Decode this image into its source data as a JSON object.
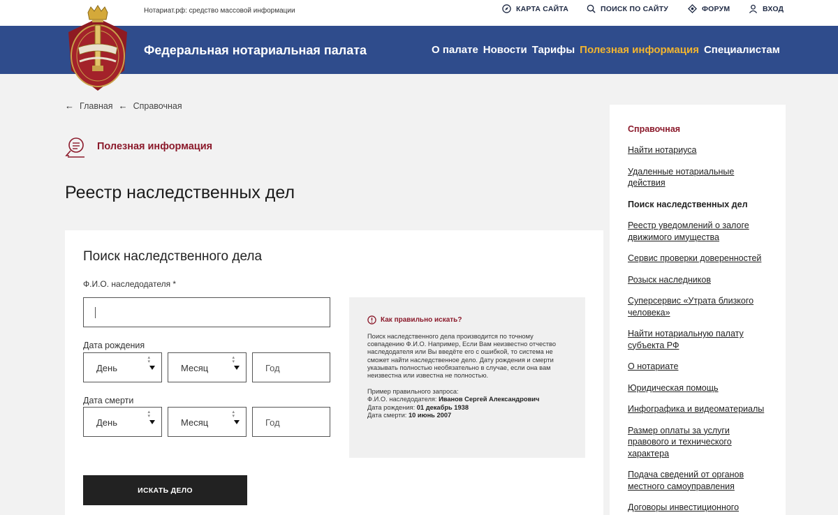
{
  "topbar": {
    "media_text": "Нотариат.рф: средство массовой информации",
    "links": [
      {
        "label": "КАРТА САЙТА",
        "icon": "compass-icon"
      },
      {
        "label": "ПОИСК ПО САЙТУ",
        "icon": "search-icon"
      },
      {
        "label": "ФОРУМ",
        "icon": "forum-icon"
      },
      {
        "label": "ВХОД",
        "icon": "user-icon"
      }
    ]
  },
  "header": {
    "brand": "Федеральная нотариальная палата",
    "nav": [
      {
        "label": "О палате"
      },
      {
        "label": "Новости"
      },
      {
        "label": "Тарифы"
      },
      {
        "label": "Полезная информация"
      },
      {
        "label": "Специалистам"
      }
    ],
    "accent_color": "#f2b530",
    "bar_color": "#2f4c8c"
  },
  "breadcrumb": {
    "arrow": "←",
    "items": [
      "Главная",
      "Справочная"
    ]
  },
  "section": {
    "label": "Полезная информация",
    "icon": "document-chat-icon",
    "color": "#8b1a2b"
  },
  "page_title": "Реестр наследственных дел",
  "form": {
    "title": "Поиск наследственного дела",
    "fio_label": "Ф.И.О. наследодателя *",
    "fio_value": "",
    "birth_label": "Дата рождения",
    "death_label": "Дата смерти",
    "day_label": "День",
    "month_label": "Месяц",
    "year_placeholder": "Год",
    "submit_label": "ИСКАТЬ ДЕЛО"
  },
  "help": {
    "title": "Как правильно искать?",
    "text": "Поиск наследственного дела производится по точному совпадению Ф.И.О. Например, Если Вам неизвестно отчество наследодателя или Вы введёте его с ошибкой, то система не сможет найти наследственное дело. Дату рождения и смерти указывать полностью необязательно в случае, если она вам неизвестна или известна не полностью.",
    "example_title": "Пример правильного запроса:",
    "example_fio_label": "Ф.И.О. наследодателя:",
    "example_fio_value": "Иванов Сергей Александрович",
    "example_birth_label": "Дата рождения:",
    "example_birth_value": "01 декабрь 1938",
    "example_death_label": "Дата смерти:",
    "example_death_value": "10 июнь 2007"
  },
  "sidebar": {
    "title": "Справочная",
    "items": [
      {
        "label": "Найти нотариуса"
      },
      {
        "label": "Удаленные нотариальные действия"
      },
      {
        "label": "Поиск наследственных дел"
      },
      {
        "label": "Реестр уведомлений о залоге движимого имущества"
      },
      {
        "label": "Сервис проверки доверенностей"
      },
      {
        "label": "Розыск наследников"
      },
      {
        "label": "Суперсервис «Утрата близкого человека»"
      },
      {
        "label": "Найти нотариальную палату субъекта РФ"
      },
      {
        "label": "О нотариате"
      },
      {
        "label": "Юридическая помощь"
      },
      {
        "label": "Инфографика и видеоматериалы"
      },
      {
        "label": "Размер оплаты за услуги правового и технического характера"
      },
      {
        "label": "Подача сведений от органов местного самоуправления"
      },
      {
        "label": "Договоры инвестиционного"
      }
    ]
  }
}
